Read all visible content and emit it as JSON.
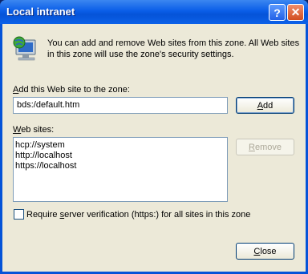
{
  "window": {
    "title": "Local intranet"
  },
  "titlebar_buttons": {
    "help": "?",
    "close": "✕"
  },
  "intro": {
    "text": "You can add and remove Web sites from this zone. All Web sites in this zone will use the zone's security settings."
  },
  "add_site": {
    "label_prefix": "",
    "label_accel": "A",
    "label_rest": "dd this Web site to the zone:",
    "value": "bds:/default.htm",
    "button_accel": "A",
    "button_rest": "dd"
  },
  "websites": {
    "label_accel": "W",
    "label_rest": "eb sites:",
    "items": [
      "hcp://system",
      "http://localhost",
      "https://localhost"
    ],
    "remove_accel": "R",
    "remove_rest": "emove"
  },
  "require_verification": {
    "checked": false,
    "label_prefix": "Require ",
    "label_accel": "s",
    "label_rest": "erver verification (https:) for all sites in this zone"
  },
  "close_button": {
    "accel": "C",
    "rest": "lose"
  },
  "colors": {
    "titlebar": "#0a5ee8",
    "client_bg": "#ece9d8",
    "border": "#7f9db9"
  }
}
